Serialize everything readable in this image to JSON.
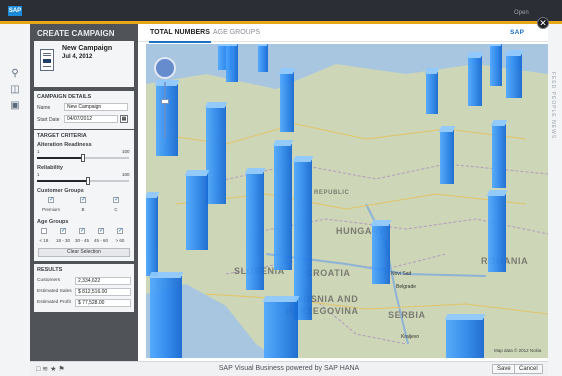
{
  "app": {
    "badge": "SAP",
    "open_label": "Open",
    "close_glyph": "✕"
  },
  "left_rail": {
    "icons": [
      "search-icon",
      "document-icon",
      "chat-icon"
    ]
  },
  "right_rail": {
    "text": "FEED PEOPLE NEWS"
  },
  "sidebar": {
    "title": "CREATE CAMPAIGN",
    "campaign": {
      "name": "New Campaign",
      "date": "Jul 4, 2012"
    },
    "details": {
      "header": "CAMPAIGN DETAILS",
      "name_label": "Name",
      "name_value": "New Campaign",
      "start_label": "Start Date",
      "start_value": "04/07/2012"
    },
    "target": {
      "header": "TARGET CRITERIA",
      "alteration": {
        "label": "Alteration Readiness",
        "min": "1",
        "max": "100",
        "value": 0.5
      },
      "reliability": {
        "label": "Reliability",
        "min": "1",
        "max": "100",
        "value": 0.55
      },
      "customer_groups": {
        "label": "Customer Groups",
        "items": [
          {
            "label": "Premium",
            "checked": true
          },
          {
            "label": "B",
            "checked": true
          },
          {
            "label": "C",
            "checked": true
          }
        ]
      },
      "age_groups": {
        "label": "Age Groups",
        "items": [
          {
            "label": "< 18",
            "checked": false
          },
          {
            "label": "18 - 30",
            "checked": true
          },
          {
            "label": "30 - 45",
            "checked": true
          },
          {
            "label": "45 - 60",
            "checked": true
          },
          {
            "label": "> 60",
            "checked": true
          }
        ]
      },
      "clear_label": "Clear Selection"
    },
    "results": {
      "header": "RESULTS",
      "rows": [
        {
          "k": "Customers",
          "v": "2,334,622"
        },
        {
          "k": "Estimated Sales",
          "v": "$ 812,516.00"
        },
        {
          "k": "Estimated Profit",
          "v": "$ 77,528.00"
        }
      ]
    }
  },
  "tabs": [
    {
      "label": "TOTAL NUMBERS",
      "active": true
    },
    {
      "label": "AGE GROUPS",
      "active": false
    }
  ],
  "logo_text": "SAP",
  "map": {
    "labels": [
      {
        "text": "REPUBLIC",
        "size": 6
      },
      {
        "text": "HUNGARY",
        "size": 9
      },
      {
        "text": "SLOVENIA",
        "size": 9
      },
      {
        "text": "CROATIA",
        "size": 9
      },
      {
        "text": "ROMANIA",
        "size": 9
      },
      {
        "text": "BOSNIA AND",
        "size": 9
      },
      {
        "text": "HERZEGOVINA",
        "size": 9
      },
      {
        "text": "SERBIA",
        "size": 9
      }
    ],
    "cities": [
      "Novi Sad",
      "Belgrade",
      "Kraljevo"
    ],
    "copyright": "Map data © 2012 Nokia"
  },
  "footer": {
    "title": "SAP Visual Business powered by SAP HANA",
    "save_label": "Save",
    "cancel_label": "Cancel",
    "icons": [
      "chat-icon",
      "rss-icon",
      "star-icon",
      "flag-icon"
    ]
  }
}
